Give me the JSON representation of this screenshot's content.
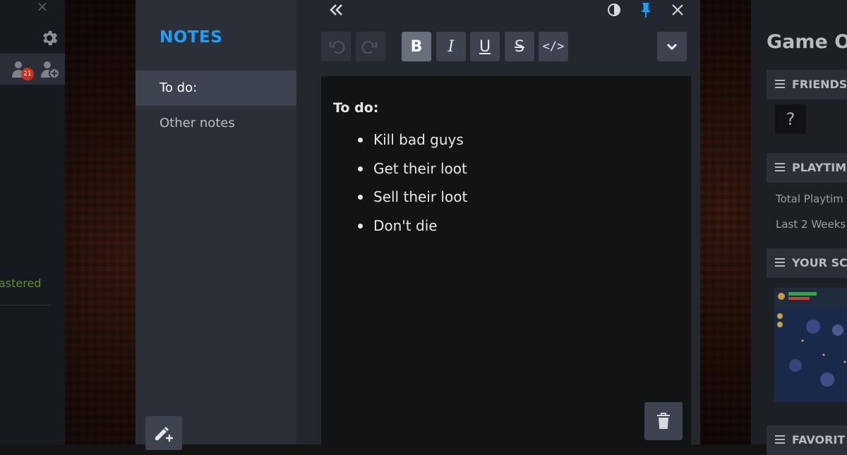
{
  "left_strip": {
    "close_glyph": "×",
    "friend_badge_count": "21",
    "status_text": "astered"
  },
  "notes": {
    "title": "NOTES",
    "items": [
      {
        "label": "To do:",
        "active": true
      },
      {
        "label": "Other notes",
        "active": false
      }
    ]
  },
  "editor": {
    "toolbar": {
      "undo": "undo-icon",
      "redo": "redo-icon",
      "bold": "B",
      "italic": "I",
      "underline": "U",
      "strike": "S",
      "code": "</>"
    },
    "heading": "To do:",
    "list": [
      "Kill bad guys",
      "Get their loot",
      "Sell their loot",
      "Don't die"
    ]
  },
  "right_panel": {
    "title": "Game O",
    "sections": [
      {
        "label": "FRIENDS"
      },
      {
        "label": "PLAYTIM"
      },
      {
        "label": "YOUR SC"
      },
      {
        "label": "FAVORIT"
      }
    ],
    "friends_unknown": "?",
    "playtime_total": "Total Playtim",
    "playtime_recent": "Last 2 Weeks"
  },
  "colors": {
    "accent": "#1a9fff",
    "sidebar_bg": "#2b3038",
    "editor_bg": "#23272e",
    "editor_area_bg": "#121315",
    "button_bg": "#3d4450",
    "button_active_bg": "#67707b",
    "badge": "#c8311f",
    "mastered_green": "#5f8a34"
  }
}
